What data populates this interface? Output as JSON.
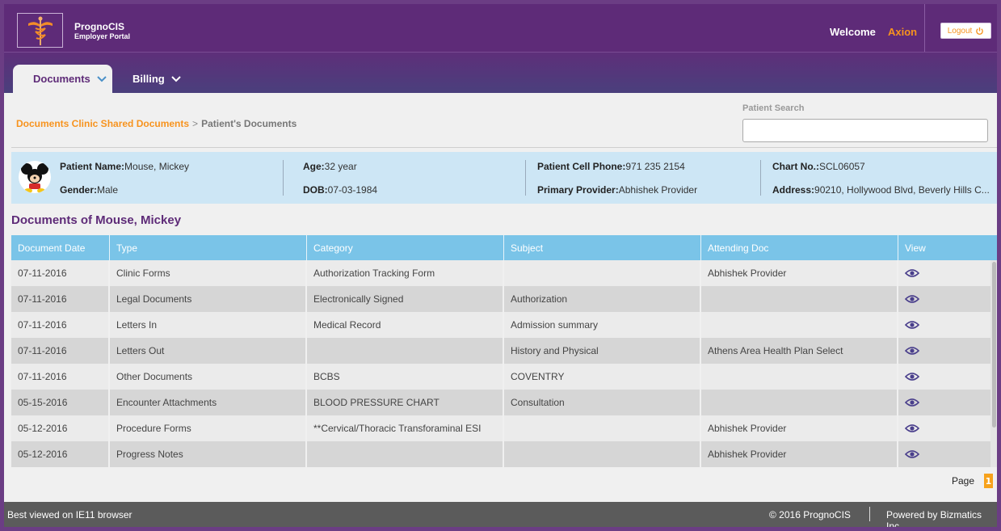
{
  "app": {
    "name": "PrognoCIS",
    "subtitle": "Employer Portal",
    "welcome_label": "Welcome",
    "username": "Axion",
    "logout_label": "Logout"
  },
  "nav": {
    "tabs": [
      {
        "label": "Documents",
        "active": true
      },
      {
        "label": "Billing",
        "active": false
      }
    ]
  },
  "breadcrumb": {
    "link": "Documents Clinic Shared Documents",
    "separator": ">",
    "current": "Patient's Documents"
  },
  "search": {
    "label": "Patient Search",
    "value": "",
    "placeholder": ""
  },
  "patient": {
    "name_label": "Patient Name:",
    "name": "Mouse, Mickey",
    "gender_label": "Gender:",
    "gender": "Male",
    "age_label": "Age:",
    "age": "32 year",
    "dob_label": "DOB:",
    "dob": "07-03-1984",
    "phone_label": "Patient Cell Phone:",
    "phone": "971 235 2154",
    "provider_label": "Primary Provider:",
    "provider": "Abhishek Provider",
    "chart_label": "Chart No.:",
    "chart": "SCL06057",
    "address_label": "Address:",
    "address": "90210, Hollywood Blvd, Beverly Hills C..."
  },
  "documents": {
    "title": "Documents of Mouse, Mickey",
    "columns": [
      "Document Date",
      "Type",
      "Category",
      "Subject",
      "Attending Doc",
      "View"
    ],
    "rows": [
      [
        "07-11-2016",
        "Clinic Forms",
        "Authorization Tracking Form",
        "",
        "Abhishek Provider"
      ],
      [
        "07-11-2016",
        "Legal Documents",
        "Electronically Signed",
        "Authorization",
        ""
      ],
      [
        "07-11-2016",
        "Letters In",
        "Medical Record",
        "Admission summary",
        ""
      ],
      [
        "07-11-2016",
        "Letters Out",
        "",
        "History and Physical",
        "Athens Area Health Plan Select"
      ],
      [
        "07-11-2016",
        "Other Documents",
        "BCBS",
        "COVENTRY",
        ""
      ],
      [
        "05-15-2016",
        "Encounter Attachments",
        "BLOOD PRESSURE CHART",
        "Consultation",
        ""
      ],
      [
        "05-12-2016",
        "Procedure Forms",
        "**Cervical/Thoracic Transforaminal ESI",
        "",
        "Abhishek Provider"
      ],
      [
        "05-12-2016",
        "Progress Notes",
        "",
        "",
        "Abhishek Provider"
      ]
    ],
    "view_icon": "eye-icon"
  },
  "pager": {
    "label": "Page",
    "current": "1"
  },
  "footer": {
    "browser_note": "Best viewed on IE11 browser",
    "copyright": "© 2016 PrognoCIS",
    "powered_by": "Powered by Bizmatics Inc"
  },
  "colors": {
    "header": "#5e2b78",
    "accent": "#f7931e",
    "table_header": "#7ac4e8",
    "banner": "#cde6f5",
    "footer": "#5b5b5b"
  }
}
